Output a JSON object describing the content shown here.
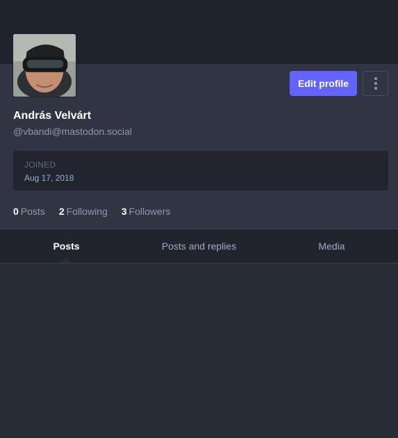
{
  "profile": {
    "display_name": "András Velvárt",
    "acct": "@vbandi@mastodon.social",
    "joined_label": "JOINED",
    "joined_date": "Aug 17, 2018"
  },
  "actions": {
    "edit_label": "Edit profile",
    "more_icon": "vertical-ellipsis-icon"
  },
  "counts": {
    "posts": {
      "num": "0",
      "label": "Posts"
    },
    "following": {
      "num": "2",
      "label": "Following"
    },
    "followers": {
      "num": "3",
      "label": "Followers"
    }
  },
  "tabs": [
    {
      "label": "Posts",
      "active": true
    },
    {
      "label": "Posts and replies",
      "active": false
    },
    {
      "label": "Media",
      "active": false
    }
  ],
  "colors": {
    "accent": "#6364ff",
    "background": "#282c37",
    "panel": "#313543"
  }
}
